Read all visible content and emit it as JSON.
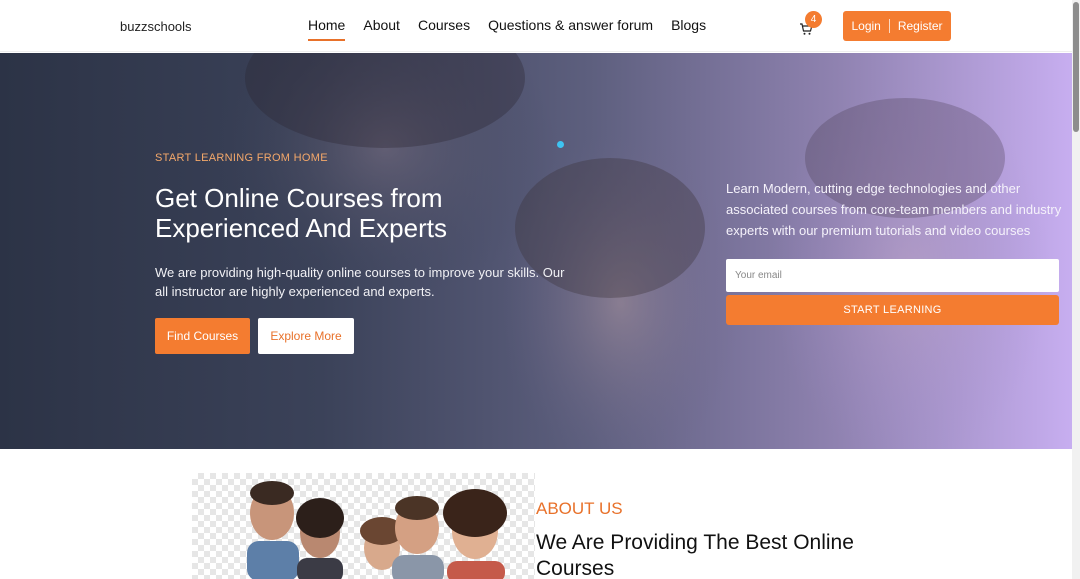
{
  "header": {
    "logo": "buzzschools",
    "nav": [
      {
        "label": "Home",
        "active": true
      },
      {
        "label": "About",
        "active": false
      },
      {
        "label": "Courses",
        "active": false
      },
      {
        "label": "Questions & answer forum",
        "active": false
      },
      {
        "label": "Blogs",
        "active": false
      }
    ],
    "cart_count": "4",
    "login_label": "Login",
    "register_label": "Register"
  },
  "hero": {
    "eyebrow": "START LEARNING FROM HOME",
    "title": "Get Online Courses from Experienced And Experts",
    "description": "We are providing high-quality online courses to improve your skills. Our all instructor are highly experienced and experts.",
    "find_courses_label": "Find Courses",
    "explore_more_label": "Explore More",
    "side_text": "Learn Modern, cutting edge technologies and other associated courses from core-team members and industry experts with our premium tutorials and video courses",
    "email_placeholder": "Your email",
    "start_learning_label": "START LEARNING"
  },
  "about": {
    "label": "ABOUT US",
    "title": "We Are Providing The Best Online Courses"
  },
  "colors": {
    "accent": "#f47c30",
    "hero_dark": "#2c3346",
    "hero_light": "#c7aef0"
  }
}
